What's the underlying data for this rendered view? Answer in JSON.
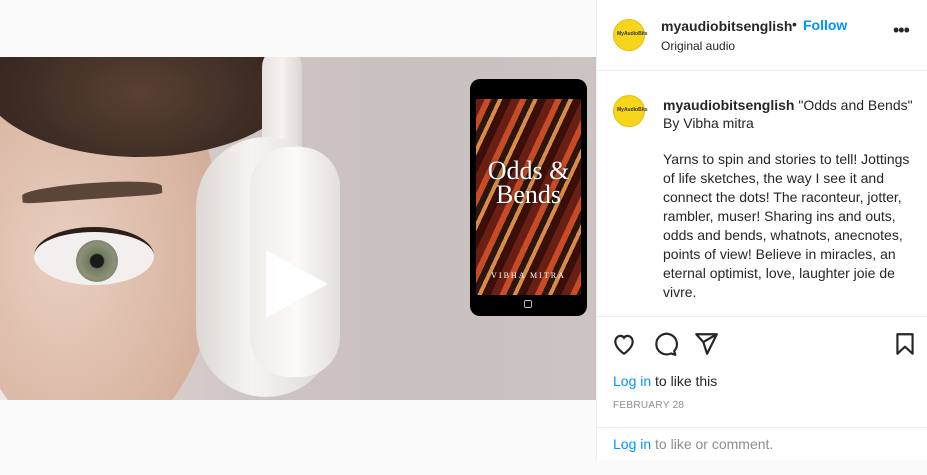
{
  "post": {
    "username": "myaudiobitsenglish",
    "separator": "•",
    "follow_label": "Follow",
    "audio_label": "Original audio",
    "more_label": "•••",
    "avatar_text": "MyAudioBits"
  },
  "media": {
    "book_title": "Odds & Bends",
    "book_author": "VIBHA MITRA",
    "icons": [
      "play-icon",
      "user-tag-icon"
    ]
  },
  "caption": {
    "username": "myaudiobitsenglish",
    "title": " \"Odds and Bends\" By Vibha mitra",
    "body": "Yarns to spin and stories to tell! Jottings of life sketches, the way I see it and connect the dots! The raconteur, jotter, rambler, muser! Sharing ins and outs, odds and bends, whatnots, anecnotes, points of view! Believe in miracles, an eternal optimist, love, laughter joie de vivre."
  },
  "actions": {
    "icons": [
      "heart-icon",
      "comment-icon",
      "share-icon",
      "bookmark-icon"
    ],
    "login_link": "Log in",
    "like_text": " to like this",
    "date": "FEBRUARY 28",
    "comment_login_link": "Log in",
    "comment_text": " to like or comment."
  },
  "colors": {
    "accent": "#0095f6",
    "avatar_bg": "#f7d51d",
    "muted": "#8e8e8e"
  }
}
